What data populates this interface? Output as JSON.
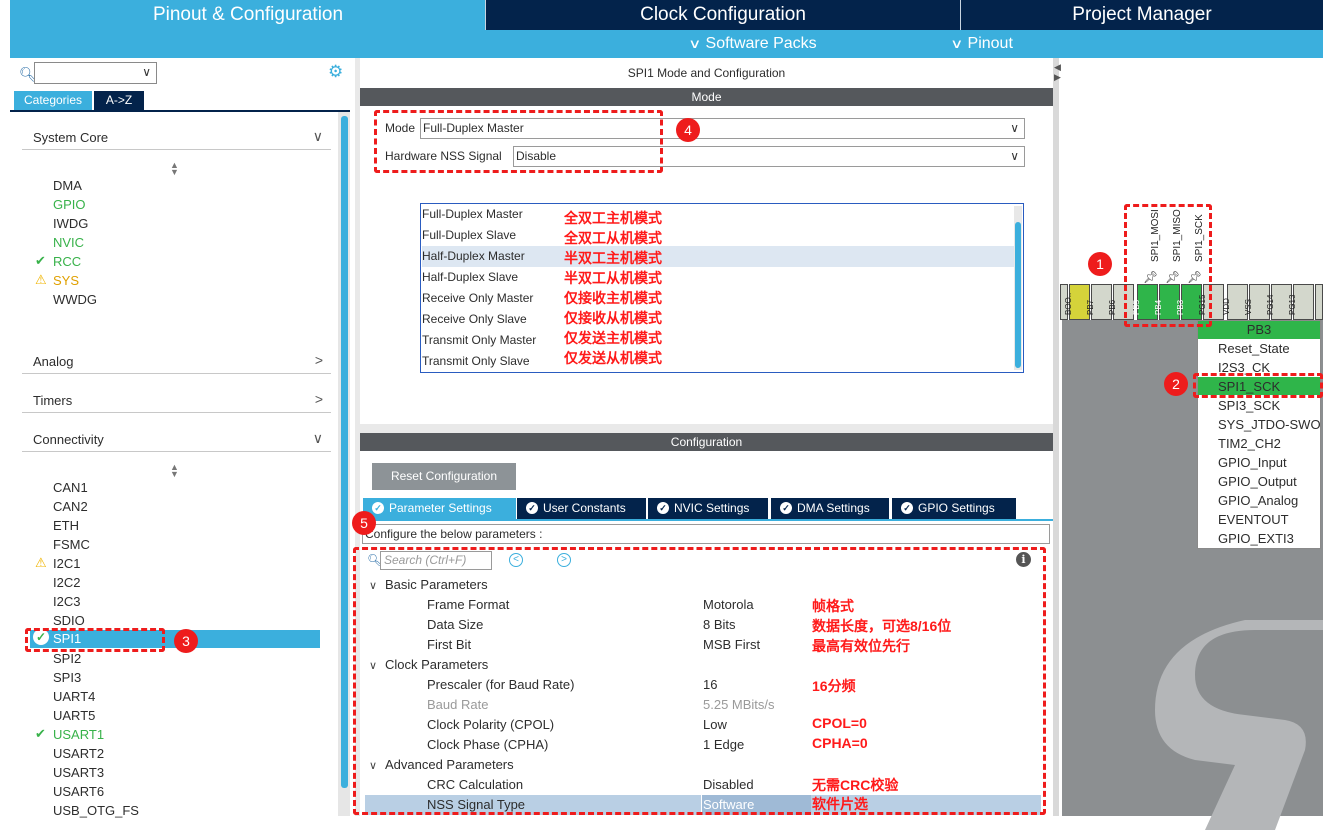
{
  "top_tabs": [
    "Pinout & Configuration",
    "Clock Configuration",
    "Project Manager"
  ],
  "sub_menu": [
    "Software Packs",
    "Pinout"
  ],
  "left": {
    "search_value": "",
    "tab_categories": "Categories",
    "tab_az": "A->Z",
    "system_core": {
      "title": "System Core",
      "items": [
        "DMA",
        "GPIO",
        "IWDG",
        "NVIC",
        "RCC",
        "SYS",
        "WWDG"
      ]
    },
    "analog_title": "Analog",
    "timers_title": "Timers",
    "connectivity": {
      "title": "Connectivity",
      "items": [
        "CAN1",
        "CAN2",
        "ETH",
        "FSMC",
        "I2C1",
        "I2C2",
        "I2C3",
        "SDIO",
        "SPI1",
        "SPI2",
        "SPI3",
        "UART4",
        "UART5",
        "USART1",
        "USART2",
        "USART3",
        "USART6",
        "USB_OTG_FS"
      ]
    }
  },
  "mode_panel": {
    "title": "SPI1 Mode and Configuration",
    "mode_bar": "Mode",
    "mode_label": "Mode",
    "mode_value": "Full-Duplex Master",
    "nss_label": "Hardware NSS Signal",
    "nss_value": "Disable",
    "options": [
      "Full-Duplex Master",
      "Full-Duplex Slave",
      "Half-Duplex Master",
      "Half-Duplex Slave",
      "Receive Only Master",
      "Receive Only Slave",
      "Transmit Only Master",
      "Transmit Only Slave"
    ],
    "option_notes": [
      "全双工主机模式",
      "全双工从机模式",
      "半双工主机模式",
      "半双工从机模式",
      "仅接收主机模式",
      "仅接收从机模式",
      "仅发送主机模式",
      "仅发送从机模式"
    ]
  },
  "config_panel": {
    "bar": "Configuration",
    "reset_button": "Reset Configuration",
    "tabs": [
      "Parameter Settings",
      "User Constants",
      "NVIC Settings",
      "DMA Settings",
      "GPIO Settings"
    ],
    "hint": "Configure the below parameters :",
    "search_placeholder": "Search (Ctrl+F)",
    "groups": {
      "basic": "Basic Parameters",
      "clock": "Clock Parameters",
      "advanced": "Advanced Parameters"
    },
    "params": [
      {
        "name": "Frame Format",
        "value": "Motorola",
        "note": "帧格式"
      },
      {
        "name": "Data Size",
        "value": "8 Bits",
        "note": "数据长度，可选8/16位"
      },
      {
        "name": "First Bit",
        "value": "MSB First",
        "note": "最高有效位先行"
      },
      {
        "name": "Prescaler (for Baud Rate)",
        "value": "16",
        "note": "16分频"
      },
      {
        "name": "Baud Rate",
        "value": "5.25 MBits/s",
        "note": ""
      },
      {
        "name": "Clock Polarity (CPOL)",
        "value": "Low",
        "note": "CPOL=0"
      },
      {
        "name": "Clock Phase (CPHA)",
        "value": "1 Edge",
        "note": "CPHA=0"
      },
      {
        "name": "CRC Calculation",
        "value": "Disabled",
        "note": "无需CRC校验"
      },
      {
        "name": "NSS Signal Type",
        "value": "Software",
        "note": "软件片选"
      }
    ]
  },
  "chip": {
    "pins": [
      "BOO..",
      "PB7",
      "PB6",
      "PB5",
      "PB4",
      "PB3",
      "PG15",
      "VDD",
      "VSS",
      "PG14",
      "PG13"
    ],
    "pin_labels": [
      "SPI1_MOSI",
      "SPI1_MISO",
      "SPI1_SCK"
    ],
    "menu_title": "PB3",
    "menu_items": [
      "Reset_State",
      "I2S3_CK",
      "SPI1_SCK",
      "SPI3_SCK",
      "SYS_JTDO-SWO",
      "TIM2_CH2",
      "GPIO_Input",
      "GPIO_Output",
      "GPIO_Analog",
      "EVENTOUT",
      "GPIO_EXTI3"
    ]
  },
  "annotations": [
    "1",
    "2",
    "3",
    "4",
    "5"
  ],
  "colors": {
    "accent": "#3bafdd",
    "navy": "#03234b",
    "annotation_red": "#ee1c1c",
    "pin_green": "#2fb54a",
    "status_green": "#38b24a"
  }
}
